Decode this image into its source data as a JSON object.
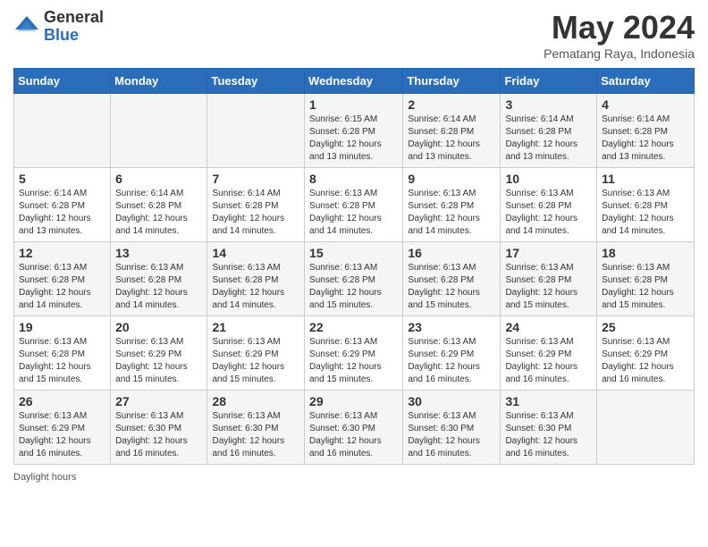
{
  "header": {
    "logo_general": "General",
    "logo_blue": "Blue",
    "month_title": "May 2024",
    "location": "Pematang Raya, Indonesia"
  },
  "weekdays": [
    "Sunday",
    "Monday",
    "Tuesday",
    "Wednesday",
    "Thursday",
    "Friday",
    "Saturday"
  ],
  "footer": {
    "daylight_label": "Daylight hours"
  },
  "weeks": [
    {
      "days": [
        {
          "num": "",
          "info": ""
        },
        {
          "num": "",
          "info": ""
        },
        {
          "num": "",
          "info": ""
        },
        {
          "num": "1",
          "info": "Sunrise: 6:15 AM\nSunset: 6:28 PM\nDaylight: 12 hours\nand 13 minutes."
        },
        {
          "num": "2",
          "info": "Sunrise: 6:14 AM\nSunset: 6:28 PM\nDaylight: 12 hours\nand 13 minutes."
        },
        {
          "num": "3",
          "info": "Sunrise: 6:14 AM\nSunset: 6:28 PM\nDaylight: 12 hours\nand 13 minutes."
        },
        {
          "num": "4",
          "info": "Sunrise: 6:14 AM\nSunset: 6:28 PM\nDaylight: 12 hours\nand 13 minutes."
        }
      ]
    },
    {
      "days": [
        {
          "num": "5",
          "info": "Sunrise: 6:14 AM\nSunset: 6:28 PM\nDaylight: 12 hours\nand 13 minutes."
        },
        {
          "num": "6",
          "info": "Sunrise: 6:14 AM\nSunset: 6:28 PM\nDaylight: 12 hours\nand 14 minutes."
        },
        {
          "num": "7",
          "info": "Sunrise: 6:14 AM\nSunset: 6:28 PM\nDaylight: 12 hours\nand 14 minutes."
        },
        {
          "num": "8",
          "info": "Sunrise: 6:13 AM\nSunset: 6:28 PM\nDaylight: 12 hours\nand 14 minutes."
        },
        {
          "num": "9",
          "info": "Sunrise: 6:13 AM\nSunset: 6:28 PM\nDaylight: 12 hours\nand 14 minutes."
        },
        {
          "num": "10",
          "info": "Sunrise: 6:13 AM\nSunset: 6:28 PM\nDaylight: 12 hours\nand 14 minutes."
        },
        {
          "num": "11",
          "info": "Sunrise: 6:13 AM\nSunset: 6:28 PM\nDaylight: 12 hours\nand 14 minutes."
        }
      ]
    },
    {
      "days": [
        {
          "num": "12",
          "info": "Sunrise: 6:13 AM\nSunset: 6:28 PM\nDaylight: 12 hours\nand 14 minutes."
        },
        {
          "num": "13",
          "info": "Sunrise: 6:13 AM\nSunset: 6:28 PM\nDaylight: 12 hours\nand 14 minutes."
        },
        {
          "num": "14",
          "info": "Sunrise: 6:13 AM\nSunset: 6:28 PM\nDaylight: 12 hours\nand 14 minutes."
        },
        {
          "num": "15",
          "info": "Sunrise: 6:13 AM\nSunset: 6:28 PM\nDaylight: 12 hours\nand 15 minutes."
        },
        {
          "num": "16",
          "info": "Sunrise: 6:13 AM\nSunset: 6:28 PM\nDaylight: 12 hours\nand 15 minutes."
        },
        {
          "num": "17",
          "info": "Sunrise: 6:13 AM\nSunset: 6:28 PM\nDaylight: 12 hours\nand 15 minutes."
        },
        {
          "num": "18",
          "info": "Sunrise: 6:13 AM\nSunset: 6:28 PM\nDaylight: 12 hours\nand 15 minutes."
        }
      ]
    },
    {
      "days": [
        {
          "num": "19",
          "info": "Sunrise: 6:13 AM\nSunset: 6:28 PM\nDaylight: 12 hours\nand 15 minutes."
        },
        {
          "num": "20",
          "info": "Sunrise: 6:13 AM\nSunset: 6:29 PM\nDaylight: 12 hours\nand 15 minutes."
        },
        {
          "num": "21",
          "info": "Sunrise: 6:13 AM\nSunset: 6:29 PM\nDaylight: 12 hours\nand 15 minutes."
        },
        {
          "num": "22",
          "info": "Sunrise: 6:13 AM\nSunset: 6:29 PM\nDaylight: 12 hours\nand 15 minutes."
        },
        {
          "num": "23",
          "info": "Sunrise: 6:13 AM\nSunset: 6:29 PM\nDaylight: 12 hours\nand 16 minutes."
        },
        {
          "num": "24",
          "info": "Sunrise: 6:13 AM\nSunset: 6:29 PM\nDaylight: 12 hours\nand 16 minutes."
        },
        {
          "num": "25",
          "info": "Sunrise: 6:13 AM\nSunset: 6:29 PM\nDaylight: 12 hours\nand 16 minutes."
        }
      ]
    },
    {
      "days": [
        {
          "num": "26",
          "info": "Sunrise: 6:13 AM\nSunset: 6:29 PM\nDaylight: 12 hours\nand 16 minutes."
        },
        {
          "num": "27",
          "info": "Sunrise: 6:13 AM\nSunset: 6:30 PM\nDaylight: 12 hours\nand 16 minutes."
        },
        {
          "num": "28",
          "info": "Sunrise: 6:13 AM\nSunset: 6:30 PM\nDaylight: 12 hours\nand 16 minutes."
        },
        {
          "num": "29",
          "info": "Sunrise: 6:13 AM\nSunset: 6:30 PM\nDaylight: 12 hours\nand 16 minutes."
        },
        {
          "num": "30",
          "info": "Sunrise: 6:13 AM\nSunset: 6:30 PM\nDaylight: 12 hours\nand 16 minutes."
        },
        {
          "num": "31",
          "info": "Sunrise: 6:13 AM\nSunset: 6:30 PM\nDaylight: 12 hours\nand 16 minutes."
        },
        {
          "num": "",
          "info": ""
        }
      ]
    }
  ]
}
